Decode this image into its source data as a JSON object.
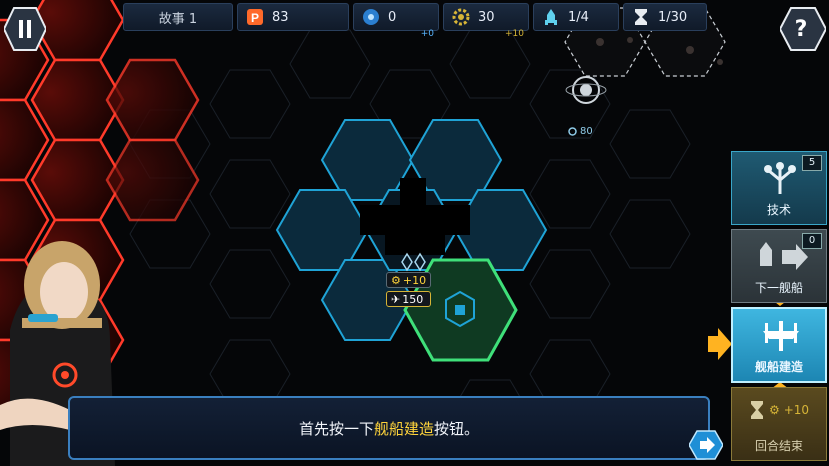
{
  "topbar": {
    "story": {
      "label": "故事 1"
    },
    "points": {
      "value": "83",
      "icon": "p-badge-icon"
    },
    "energy": {
      "value": "0",
      "delta": "+0",
      "icon": "energy-icon"
    },
    "gear": {
      "value": "30",
      "delta": "+10",
      "icon": "gear-icon"
    },
    "fleet": {
      "value": "1/4",
      "icon": "rocket-icon"
    },
    "turns": {
      "value": "1/30",
      "icon": "hourglass-icon"
    }
  },
  "buttons": {
    "pause_icon": "pause-icon",
    "help_label": "?"
  },
  "side_panel": {
    "tech": {
      "label": "技术",
      "badge": "5"
    },
    "launch": {
      "label": "下一舰船",
      "badge": "0"
    },
    "shipbuild": {
      "label": "舰船建造"
    },
    "end_turn": {
      "label": "回合结束",
      "gear_delta": "+10"
    }
  },
  "unit": {
    "gear_bonus": "+10",
    "hp": "150"
  },
  "planet": {
    "value": "80"
  },
  "dialog": {
    "text_before": "首先按一下",
    "text_highlight": "舰船建造",
    "text_after": "按钮。"
  },
  "colors": {
    "accent_blue": "#3aa6c8",
    "highlight_yellow": "#ffd43b",
    "enemy_red": "#c8281e",
    "friendly_green": "#3fe07a"
  }
}
